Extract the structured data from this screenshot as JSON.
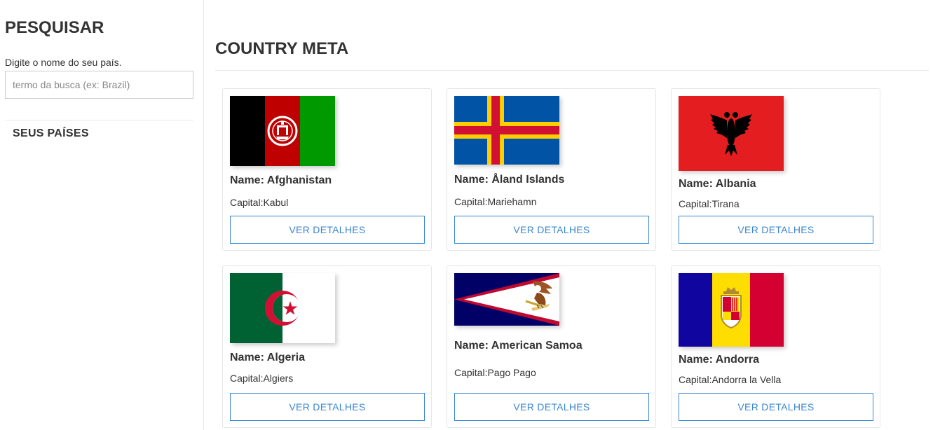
{
  "sidebar": {
    "title": "PESQUISAR",
    "hint": "Digite o nome do seu país.",
    "search_placeholder": "termo da busca (ex: Brazil)",
    "search_value": "",
    "yours_heading": "SEUS PAÍSES"
  },
  "main": {
    "title": "COUNTRY META"
  },
  "countries": [
    {
      "name_label": "Name: Afghanistan",
      "capital_label": "Capital:Kabul",
      "button_label": "VER DETALHES"
    },
    {
      "name_label": "Name: Åland Islands",
      "capital_label": "Capital:Mariehamn",
      "button_label": "VER DETALHES"
    },
    {
      "name_label": "Name: Albania",
      "capital_label": "Capital:Tirana",
      "button_label": "VER DETALHES"
    },
    {
      "name_label": "Name: Algeria",
      "capital_label": "Capital:Algiers",
      "button_label": "VER DETALHES"
    },
    {
      "name_label": "Name: American Samoa",
      "capital_label": "Capital:Pago Pago",
      "button_label": "VER DETALHES"
    },
    {
      "name_label": "Name: Andorra",
      "capital_label": "Capital:Andorra la Vella",
      "button_label": "VER DETALHES"
    }
  ],
  "colors": {
    "accent": "#3a86d1",
    "text": "#333333",
    "border": "#e6e6e6"
  }
}
